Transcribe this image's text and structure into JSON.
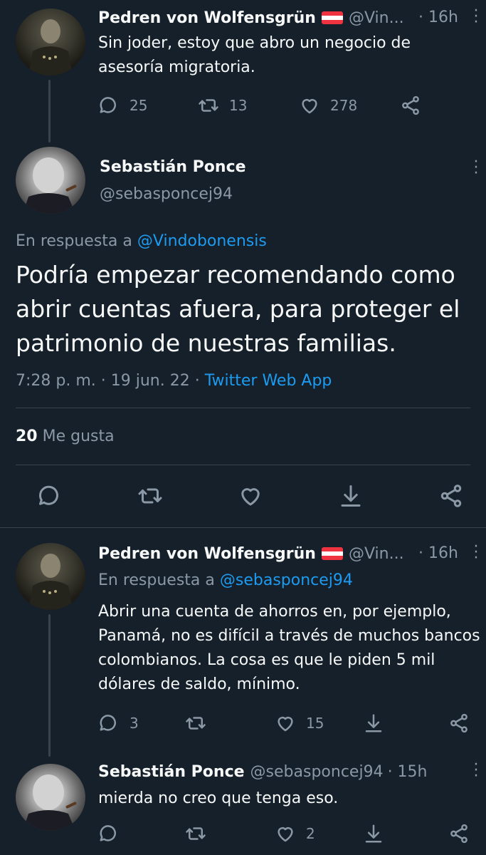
{
  "tweets": [
    {
      "name": "Pedren von Wolfensgrün",
      "handle": "@Vin...",
      "time": "· 16h",
      "text": "Sin joder, estoy que abro un negocio de asesoría migratoria.",
      "replies": "25",
      "retweets": "13",
      "likes": "278"
    },
    {
      "name": "Pedren von Wolfensgrün",
      "handle": "@Vin...",
      "time": "· 16h",
      "reply_prefix": "En respuesta a",
      "reply_to": "@sebasponcej94",
      "text": "Abrir una cuenta de ahorros en, por ejemplo, Panamá, no es difícil a través de muchos bancos colombianos. La cosa es que le piden 5 mil dólares de saldo, mínimo.",
      "replies": "3",
      "retweets": "",
      "likes": "15"
    },
    {
      "name": "Sebastián Ponce",
      "handle": "@sebasponcej94",
      "time": "· 15h",
      "text": "mierda no creo que tenga eso.",
      "replies": "",
      "retweets": "",
      "likes": "2"
    }
  ],
  "focus": {
    "name": "Sebastián Ponce",
    "handle": "@sebasponcej94",
    "reply_prefix": "En respuesta a",
    "reply_to": "@Vindobonensis",
    "text": "Podría empezar recomendando como abrir cuentas afuera, para proteger el patrimonio de nuestras familias.",
    "timestamp": "7:28 p. m. · 19 jun. 22 ·",
    "source": "Twitter Web App",
    "likes_count": "20",
    "likes_label": "Me gusta"
  },
  "colors": {
    "background": "#15202b",
    "text": "#f7f9f9",
    "muted": "#8b98a5",
    "accent": "#1d9bf0",
    "divider": "#38444d"
  },
  "icons": [
    "reply-icon",
    "retweet-icon",
    "like-icon",
    "share-icon",
    "download-icon",
    "more-icon",
    "austria-flag-icon"
  ]
}
